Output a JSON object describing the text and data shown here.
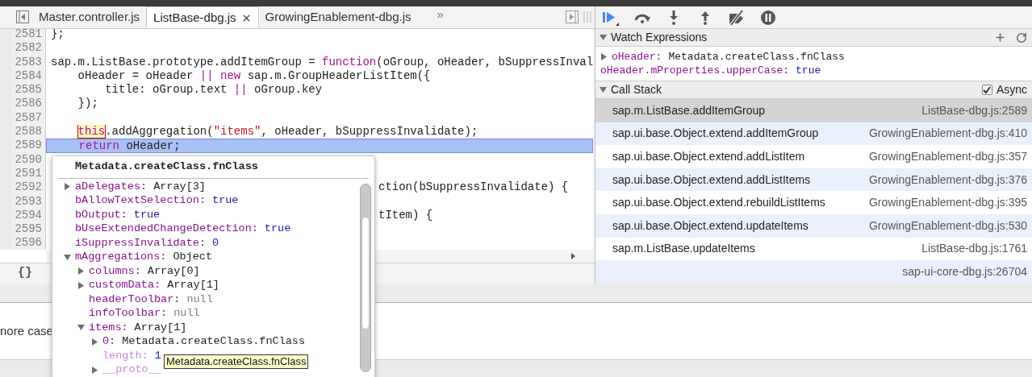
{
  "editor": {
    "tabs": [
      {
        "label": "Master.controller.js",
        "selected": false
      },
      {
        "label": "ListBase-dbg.js",
        "selected": true
      },
      {
        "label": "GrowingEnablement-dbg.js",
        "selected": false
      }
    ],
    "overflow": "»",
    "lines": [
      {
        "number": "2581",
        "highlighted": false,
        "segments": [
          {
            "t": "};",
            "kind": "plain"
          }
        ]
      },
      {
        "number": "2582",
        "highlighted": false
      },
      {
        "number": "2583",
        "highlighted": false,
        "segments": [
          {
            "t": "sap.m.ListBase.prototype.addItemGroup = ",
            "kind": "plain"
          },
          {
            "t": "function",
            "kind": "keyword"
          },
          {
            "t": "(oGroup, oHeader, bSuppressInval",
            "kind": "plain"
          }
        ]
      },
      {
        "number": "2584",
        "highlighted": false,
        "segments": [
          {
            "t": "    oHeader = oHeader ",
            "kind": "plain"
          },
          {
            "t": "||",
            "kind": "keyword"
          },
          {
            "t": " new",
            "kind": "keyword"
          },
          {
            "t": " sap.m.GroupHeaderListItem({",
            "kind": "plain"
          }
        ]
      },
      {
        "number": "2585",
        "highlighted": false,
        "segments": [
          {
            "t": "        title: oGroup.text ",
            "kind": "plain"
          },
          {
            "t": "||",
            "kind": "keyword"
          },
          {
            "t": " oGroup.key",
            "kind": "plain"
          }
        ]
      },
      {
        "number": "2586",
        "highlighted": false,
        "segments": [
          {
            "t": "    });",
            "kind": "plain"
          }
        ]
      },
      {
        "number": "2587",
        "highlighted": false
      },
      {
        "number": "2588",
        "highlighted": false,
        "segments": [
          {
            "t": "    this",
            "kind": "hover"
          },
          {
            "t": ".addAggregation(",
            "kind": "plain"
          },
          {
            "t": "\"items\"",
            "kind": "string"
          },
          {
            "t": ", oHeader, bSuppressInvalidate);",
            "kind": "plain"
          }
        ]
      },
      {
        "number": "2589",
        "highlighted": true,
        "segments": [
          {
            "t": "    return",
            "kind": "keyword"
          },
          {
            "t": " oHeader;",
            "kind": "plain"
          }
        ]
      },
      {
        "number": "2590",
        "highlighted": false
      },
      {
        "number": "2591",
        "highlighted": false
      },
      {
        "number": "2592",
        "highlighted": false,
        "tail": "ction(bSuppressInvalidate) {"
      },
      {
        "number": "2593",
        "highlighted": false
      },
      {
        "number": "2594",
        "highlighted": false,
        "tail": "tItem) {"
      },
      {
        "number": "2595",
        "highlighted": false
      },
      {
        "number": "2596",
        "highlighted": false
      }
    ],
    "status_glyph": "{}"
  },
  "popover": {
    "title": "Metadata.createClass.fnClass",
    "properties": [
      {
        "key": "aDelegates:",
        "value": "Array[3]",
        "kind": "object",
        "expanded": false
      },
      {
        "key": "bAllowTextSelection:",
        "value": "true",
        "kind": "boolean"
      },
      {
        "key": "bOutput:",
        "value": "true",
        "kind": "boolean"
      },
      {
        "key": "bUseExtendedChangeDetection:",
        "value": "true",
        "kind": "boolean"
      },
      {
        "key": "iSuppressInvalidate:",
        "value": "0",
        "kind": "number"
      },
      {
        "key": "mAggregations:",
        "value": "Object",
        "kind": "object",
        "expanded": true,
        "children": [
          {
            "key": "columns:",
            "value": "Array[0]",
            "kind": "object",
            "expanded": false
          },
          {
            "key": "customData:",
            "value": "Array[1]",
            "kind": "object",
            "expanded": false
          },
          {
            "key": "headerToolbar:",
            "value": "null",
            "kind": "null"
          },
          {
            "key": "infoToolbar:",
            "value": "null",
            "kind": "null"
          },
          {
            "key": "items:",
            "value": "Array[1]",
            "kind": "object",
            "expanded": true,
            "children": [
              {
                "key": "0:",
                "value": "Metadata.createClass.fnClass",
                "kind": "object",
                "expanded": false,
                "dimmed": false
              },
              {
                "key": "length:",
                "value": "1",
                "kind": "number",
                "dimmed": true
              },
              {
                "key": "__proto__",
                "expanded": false,
                "dimmed": true
              }
            ]
          }
        ]
      }
    ],
    "tooltip": "Metadata.createClass.fnClass"
  },
  "watch": {
    "title": "Watch Expressions",
    "expanded": true,
    "items": [
      {
        "name": "oHeader:",
        "value": "Metadata.createClass.fnClass",
        "kind": "object",
        "expanded": false
      },
      {
        "name": "oHeader.mProperties.upperCase:",
        "value": "true",
        "kind": "boolean"
      }
    ]
  },
  "call_stack": {
    "title": "Call Stack",
    "expanded": true,
    "async": {
      "label": "Async",
      "checked": true
    },
    "frames": [
      {
        "function": "sap.m.ListBase.addItemGroup",
        "location": "ListBase-dbg.js:2589",
        "selected": true
      },
      {
        "function": "sap.ui.base.Object.extend.addItemGroup",
        "location": "GrowingEnablement-dbg.js:410",
        "selected": false
      },
      {
        "function": "sap.ui.base.Object.extend.addListItem",
        "location": "GrowingEnablement-dbg.js:357",
        "selected": false
      },
      {
        "function": "sap.ui.base.Object.extend.addListItems",
        "location": "GrowingEnablement-dbg.js:376",
        "selected": false
      },
      {
        "function": "sap.ui.base.Object.extend.rebuildListItems",
        "location": "GrowingEnablement-dbg.js:395",
        "selected": false
      },
      {
        "function": "sap.ui.base.Object.extend.updateItems",
        "location": "GrowingEnablement-dbg.js:530",
        "selected": false
      },
      {
        "function": "sap.m.ListBase.updateItems",
        "location": "ListBase-dbg.js:1761",
        "selected": false
      },
      {
        "location": "sap-ui-core-dbg.js:26704",
        "selected": false
      }
    ]
  },
  "console": {
    "text": "nore case"
  }
}
